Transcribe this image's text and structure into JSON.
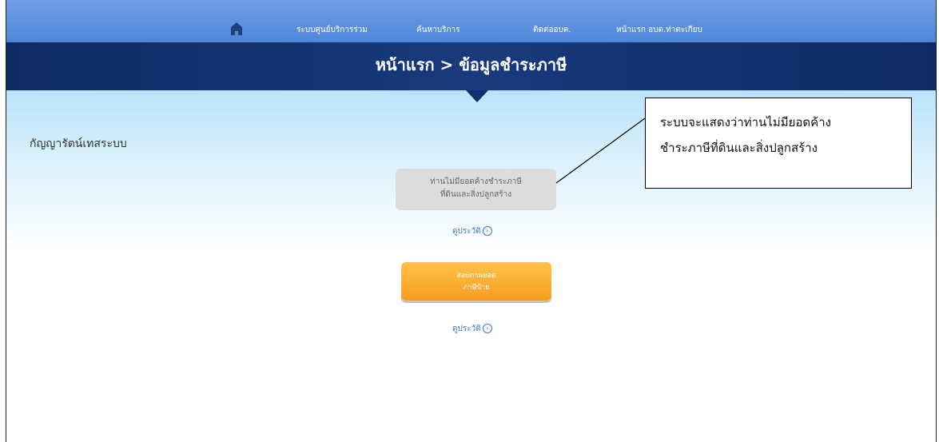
{
  "nav": {
    "home_icon": "home-icon",
    "items": [
      "ระบบศูนย์บริการร่วม",
      "ค้นหาบริการ",
      "ติดต่ออบต.",
      "หน้าแรก อบต.ท่าตะเกียบ"
    ]
  },
  "banner": {
    "title": "หน้าแรก > ข้อมูลชำระภาษี"
  },
  "user": {
    "name": "กัญญารัตน์เทสระบบ"
  },
  "status": {
    "line1": "ท่านไม่มียอดค้างชำระภาษี",
    "line2": "ที่ดินและสิ่งปลูกสร้าง"
  },
  "history_link": "ดูประวัติ",
  "inquiry_button": {
    "line1": "สอบถามยอด",
    "line2": "ภาษีป้าย"
  },
  "callout": {
    "line1": "ระบบจะแสดงว่าท่านไม่มียอดค้าง",
    "line2": "ชำระภาษีที่ดินและสิ่งปลูกสร้าง"
  },
  "colors": {
    "nav": "#5b8fdd",
    "banner": "#14336f",
    "button": "#f7a52a",
    "link": "#3f78d4"
  }
}
